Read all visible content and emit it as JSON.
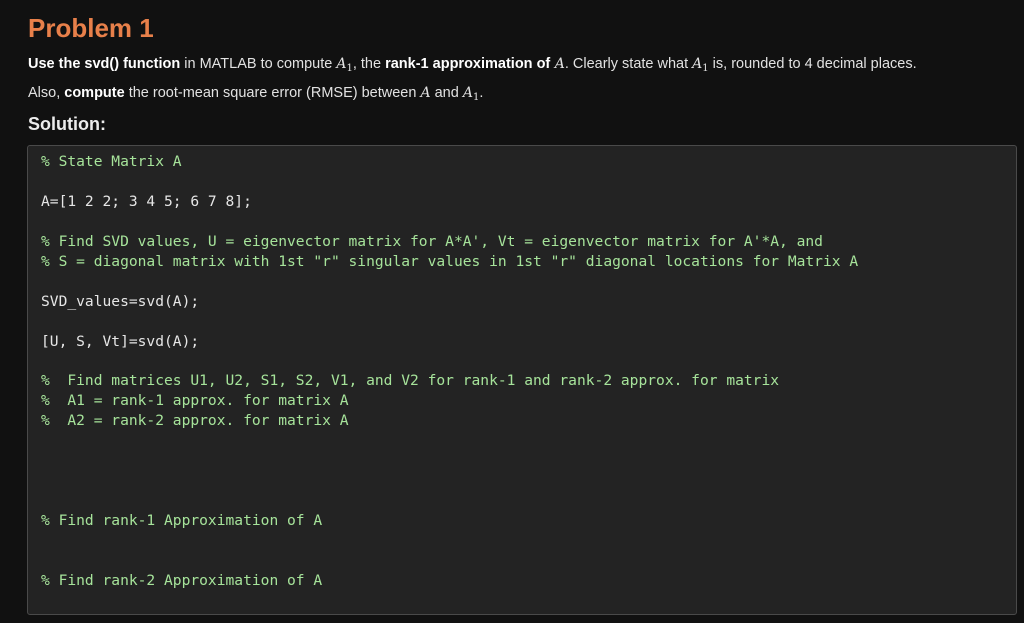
{
  "problem": {
    "title": "Problem 1",
    "line1": {
      "p1": "Use the svd() function",
      "p2": " in MATLAB to compute ",
      "p3": "A",
      "p3sub": "1",
      "p4": ", the ",
      "p5": "rank-1 approximation of",
      "p6": " A",
      "p7": ". Clearly state what ",
      "p8": "A",
      "p8sub": "1",
      "p9": " is, rounded to 4 decimal places."
    },
    "line2": {
      "p1": "Also, ",
      "p2": "compute",
      "p3": " the root-mean square error (RMSE) between ",
      "p4": "A",
      "p5": " and ",
      "p6": "A",
      "p6sub": "1",
      "p7": "."
    }
  },
  "solution_label": "Solution:",
  "editor": {
    "lines": [
      "% State Matrix A",
      "A=[1 2 2; 3 4 5; 6 7 8];",
      "% Find SVD values, U = eigenvector matrix for A*A', Vt = eigenvector matrix for A'*A, and",
      "% S = diagonal matrix with 1st \"r\" singular values in 1st \"r\" diagonal locations for Matrix A",
      "SVD_values=svd(A);",
      "[U, S, Vt]=svd(A);",
      "%  Find matrices U1, U2, S1, S2, V1, and V2 for rank-1 and rank-2 approx. for matrix",
      "%  A1 = rank-1 approx. for matrix A",
      "%  A2 = rank-2 approx. for matrix A",
      "% Find rank-1 Approximation of A",
      "% Find rank-2 Approximation of A"
    ]
  }
}
